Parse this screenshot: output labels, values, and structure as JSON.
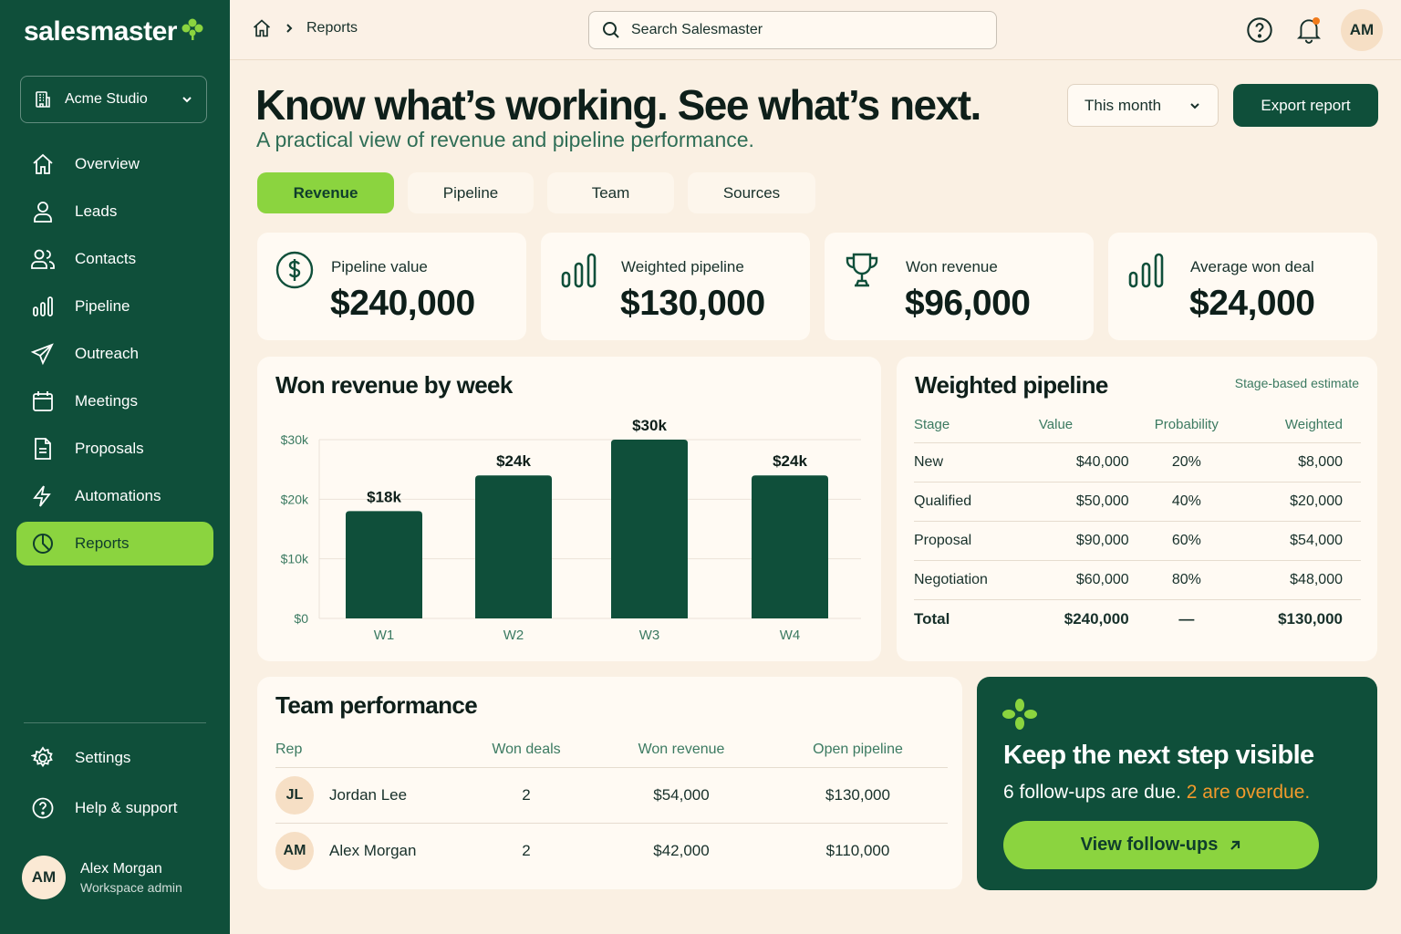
{
  "brand": {
    "name": "salesmaster",
    "accent": "#8bd43f",
    "primary": "#0f4f3a",
    "warning": "#f29a2c"
  },
  "workspace": {
    "name": "Acme Studio"
  },
  "sidebar": {
    "items": [
      {
        "label": "Overview",
        "icon": "home-icon"
      },
      {
        "label": "Leads",
        "icon": "user-icon"
      },
      {
        "label": "Contacts",
        "icon": "users-icon"
      },
      {
        "label": "Pipeline",
        "icon": "bar-chart-icon"
      },
      {
        "label": "Outreach",
        "icon": "send-icon"
      },
      {
        "label": "Meetings",
        "icon": "calendar-icon"
      },
      {
        "label": "Proposals",
        "icon": "document-icon"
      },
      {
        "label": "Automations",
        "icon": "lightning-icon"
      },
      {
        "label": "Reports",
        "icon": "pie-chart-icon",
        "active": true
      }
    ],
    "bottom": [
      {
        "label": "Settings",
        "icon": "gear-icon"
      },
      {
        "label": "Help & support",
        "icon": "help-icon"
      }
    ],
    "user": {
      "initials": "AM",
      "name": "Alex Morgan",
      "role": "Workspace admin"
    }
  },
  "topbar": {
    "breadcrumb": "Reports",
    "search_placeholder": "Search Salesmaster",
    "avatar_initials": "AM"
  },
  "header": {
    "title": "Know what’s working. See what’s next.",
    "subtitle": "A practical view of revenue and pipeline performance.",
    "period": "This month",
    "export_label": "Export report"
  },
  "tabs": [
    {
      "label": "Revenue",
      "active": true
    },
    {
      "label": "Pipeline"
    },
    {
      "label": "Team"
    },
    {
      "label": "Sources"
    }
  ],
  "kpis": [
    {
      "label": "Pipeline value",
      "value": "$240,000",
      "icon": "dollar-icon"
    },
    {
      "label": "Weighted pipeline",
      "value": "$130,000",
      "icon": "bar-chart-icon"
    },
    {
      "label": "Won revenue",
      "value": "$96,000",
      "icon": "trophy-icon"
    },
    {
      "label": "Average won deal",
      "value": "$24,000",
      "icon": "bar-chart-icon"
    }
  ],
  "chart": {
    "title": "Won revenue by week"
  },
  "chart_data": {
    "type": "bar",
    "title": "Won revenue by week",
    "categories": [
      "W1",
      "W2",
      "W3",
      "W4"
    ],
    "values": [
      18,
      24,
      30,
      24
    ],
    "data_labels": [
      "$18k",
      "$24k",
      "$30k",
      "$24k"
    ],
    "yticks": [
      0,
      10,
      20,
      30
    ],
    "ytick_labels": [
      "$0",
      "$10k",
      "$20k",
      "$30k"
    ],
    "ylim": [
      0,
      30
    ],
    "grid": true,
    "bar_color": "#0f4f3a"
  },
  "weighted": {
    "title": "Weighted pipeline",
    "note": "Stage-based estimate",
    "headers": [
      "Stage",
      "Value",
      "Probability",
      "Weighted"
    ],
    "rows": [
      [
        "New",
        "$40,000",
        "20%",
        "$8,000"
      ],
      [
        "Qualified",
        "$50,000",
        "40%",
        "$20,000"
      ],
      [
        "Proposal",
        "$90,000",
        "60%",
        "$54,000"
      ],
      [
        "Negotiation",
        "$60,000",
        "80%",
        "$48,000"
      ]
    ],
    "total": [
      "Total",
      "$240,000",
      "—",
      "$130,000"
    ]
  },
  "team": {
    "title": "Team performance",
    "headers": [
      "Rep",
      "Won deals",
      "Won revenue",
      "Open pipeline"
    ],
    "rows": [
      {
        "initials": "JL",
        "name": "Jordan Lee",
        "won_deals": "2",
        "won_revenue": "$54,000",
        "open_pipeline": "$130,000"
      },
      {
        "initials": "AM",
        "name": "Alex Morgan",
        "won_deals": "2",
        "won_revenue": "$42,000",
        "open_pipeline": "$110,000"
      }
    ]
  },
  "cta": {
    "title": "Keep the next step visible",
    "sub_prefix": "6 follow-ups are due.",
    "sub_highlight": "2 are overdue.",
    "button": "View follow-ups"
  }
}
